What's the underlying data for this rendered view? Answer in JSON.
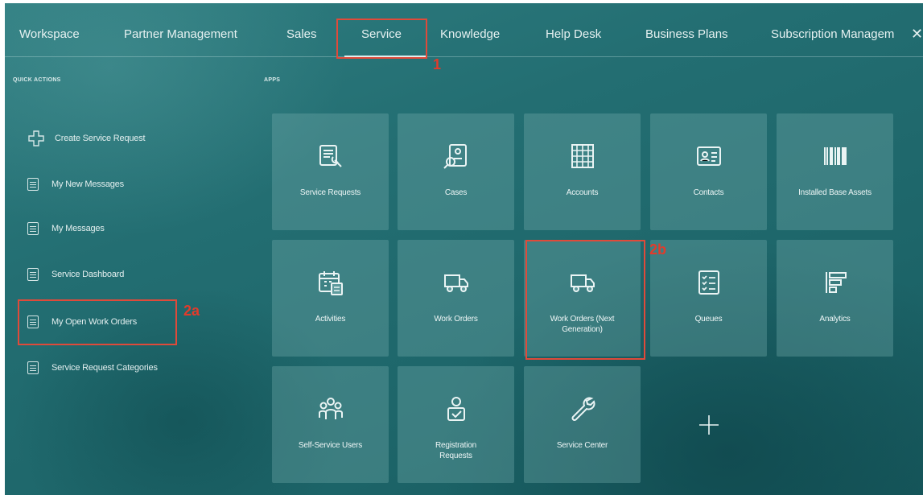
{
  "nav": {
    "tabs": [
      "Workspace",
      "Partner Management",
      "Sales",
      "Service",
      "Knowledge",
      "Help Desk",
      "Business Plans",
      "Subscription Managem"
    ],
    "active_tab": "Service",
    "more_icon": "close-icon"
  },
  "annotations": {
    "a1": "1",
    "a2a": "2a",
    "a2b": "2b",
    "color": "#e04a3a"
  },
  "quick_actions": {
    "title": "QUICK ACTIONS",
    "items": [
      {
        "label": "Create Service Request",
        "icon": "plus-icon"
      },
      {
        "label": "My New Messages",
        "icon": "document-icon"
      },
      {
        "label": "My Messages",
        "icon": "document-icon"
      },
      {
        "label": "Service Dashboard",
        "icon": "document-icon"
      },
      {
        "label": "My Open Work Orders",
        "icon": "document-icon"
      },
      {
        "label": "Service Request Categories",
        "icon": "document-icon"
      }
    ]
  },
  "apps": {
    "title": "APPS",
    "tiles": [
      {
        "label": "Service Requests",
        "icon": "service-request-icon"
      },
      {
        "label": "Cases",
        "icon": "case-icon"
      },
      {
        "label": "Accounts",
        "icon": "building-icon"
      },
      {
        "label": "Contacts",
        "icon": "contact-card-icon"
      },
      {
        "label": "Installed Base Assets",
        "icon": "barcode-icon"
      },
      {
        "label": "Activities",
        "icon": "calendar-icon"
      },
      {
        "label": "Work Orders",
        "icon": "truck-icon"
      },
      {
        "label": "Work Orders (Next Generation)",
        "icon": "truck-icon"
      },
      {
        "label": "Queues",
        "icon": "checklist-icon"
      },
      {
        "label": "Analytics",
        "icon": "analytics-icon"
      },
      {
        "label": "Self-Service Users",
        "icon": "users-icon"
      },
      {
        "label": "Registration Requests",
        "icon": "user-check-icon"
      },
      {
        "label": "Service Center",
        "icon": "wrench-icon"
      },
      {
        "label": "",
        "icon": "add-icon"
      }
    ]
  },
  "colors": {
    "background": "#236e72",
    "tile": "#5fa0a2",
    "text": "#e8f2f2"
  }
}
